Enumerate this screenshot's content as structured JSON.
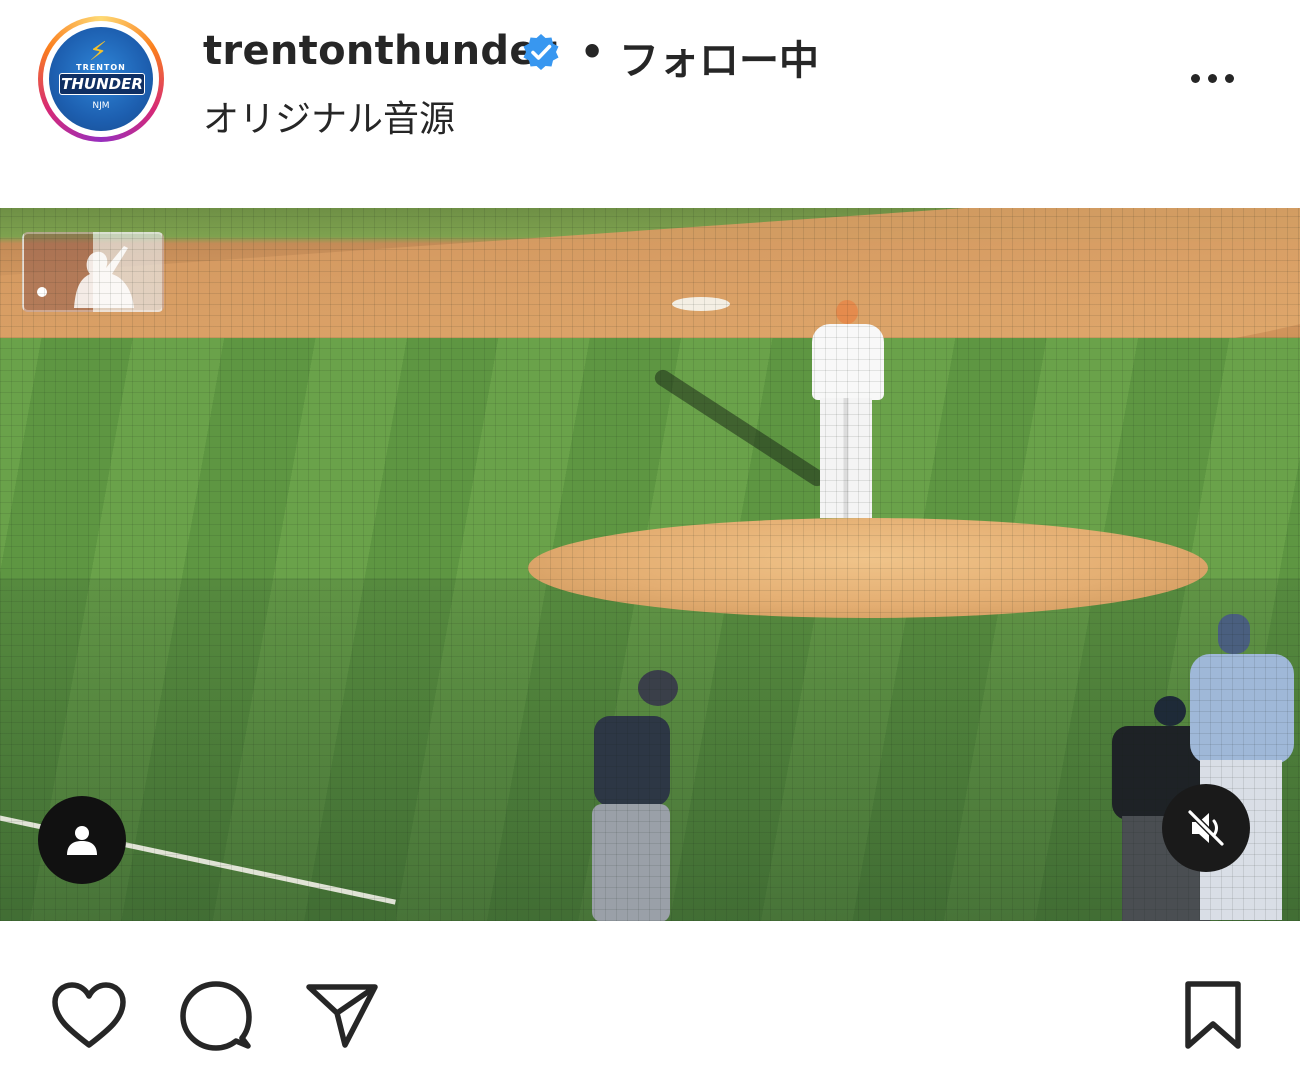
{
  "header": {
    "username": "trentonthunder",
    "separator": "•",
    "follow_status": "フォロー中",
    "audio": "オリジナル音源",
    "avatar_text_top": "TRENTON",
    "avatar_text_main": "THUNDER",
    "avatar_text_sub": "NJM",
    "verified": true
  },
  "icons": {
    "more": "more-options-icon",
    "tag": "user-tag-icon",
    "mute": "speaker-muted-icon",
    "like": "heart-icon",
    "comment": "comment-bubble-icon",
    "share": "paper-plane-icon",
    "save": "bookmark-icon"
  },
  "colors": {
    "text": "#262626",
    "verified_blue": "#3897f0",
    "overlay_button": "#111111",
    "background": "#ffffff"
  }
}
